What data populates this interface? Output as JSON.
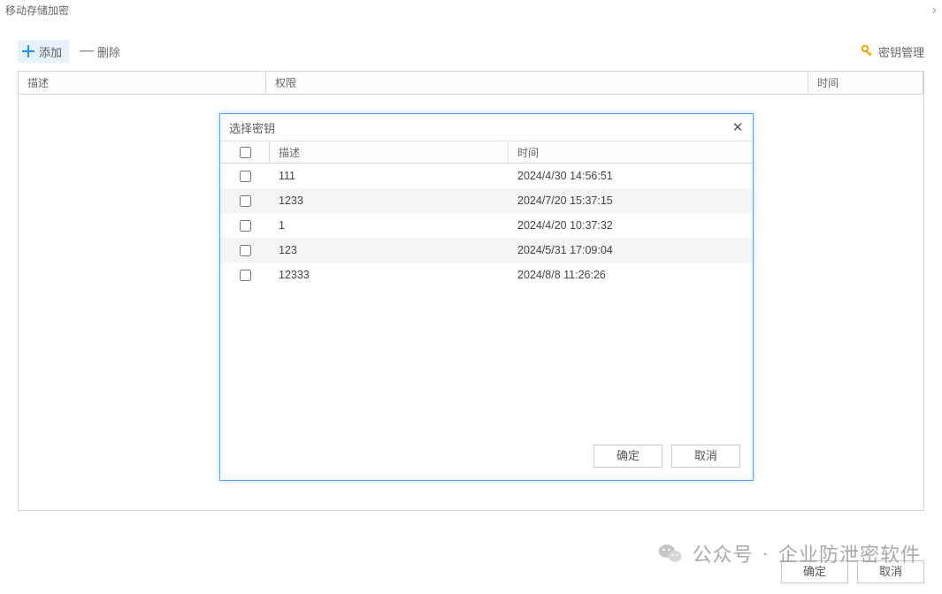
{
  "window": {
    "title": "移动存储加密"
  },
  "toolbar": {
    "add_label": "添加",
    "remove_label": "删除",
    "key_mgmt_label": "密钥管理"
  },
  "main_table": {
    "columns": {
      "description": "描述",
      "permission": "权限",
      "time": "时间"
    }
  },
  "main_footer": {
    "ok": "确定",
    "cancel": "取消"
  },
  "dialog": {
    "title": "选择密钥",
    "columns": {
      "description": "描述",
      "time": "时间"
    },
    "rows": [
      {
        "desc": "111",
        "time": "2024/4/30 14:56:51"
      },
      {
        "desc": "1233",
        "time": "2024/7/20 15:37:15"
      },
      {
        "desc": "1",
        "time": "2024/4/20 10:37:32"
      },
      {
        "desc": "123",
        "time": "2024/5/31 17:09:04"
      },
      {
        "desc": "12333",
        "time": "2024/8/8 11:26:26"
      }
    ],
    "ok": "确定",
    "cancel": "取消"
  },
  "watermark": {
    "prefix": "公众号",
    "name": "企业防泄密软件"
  }
}
